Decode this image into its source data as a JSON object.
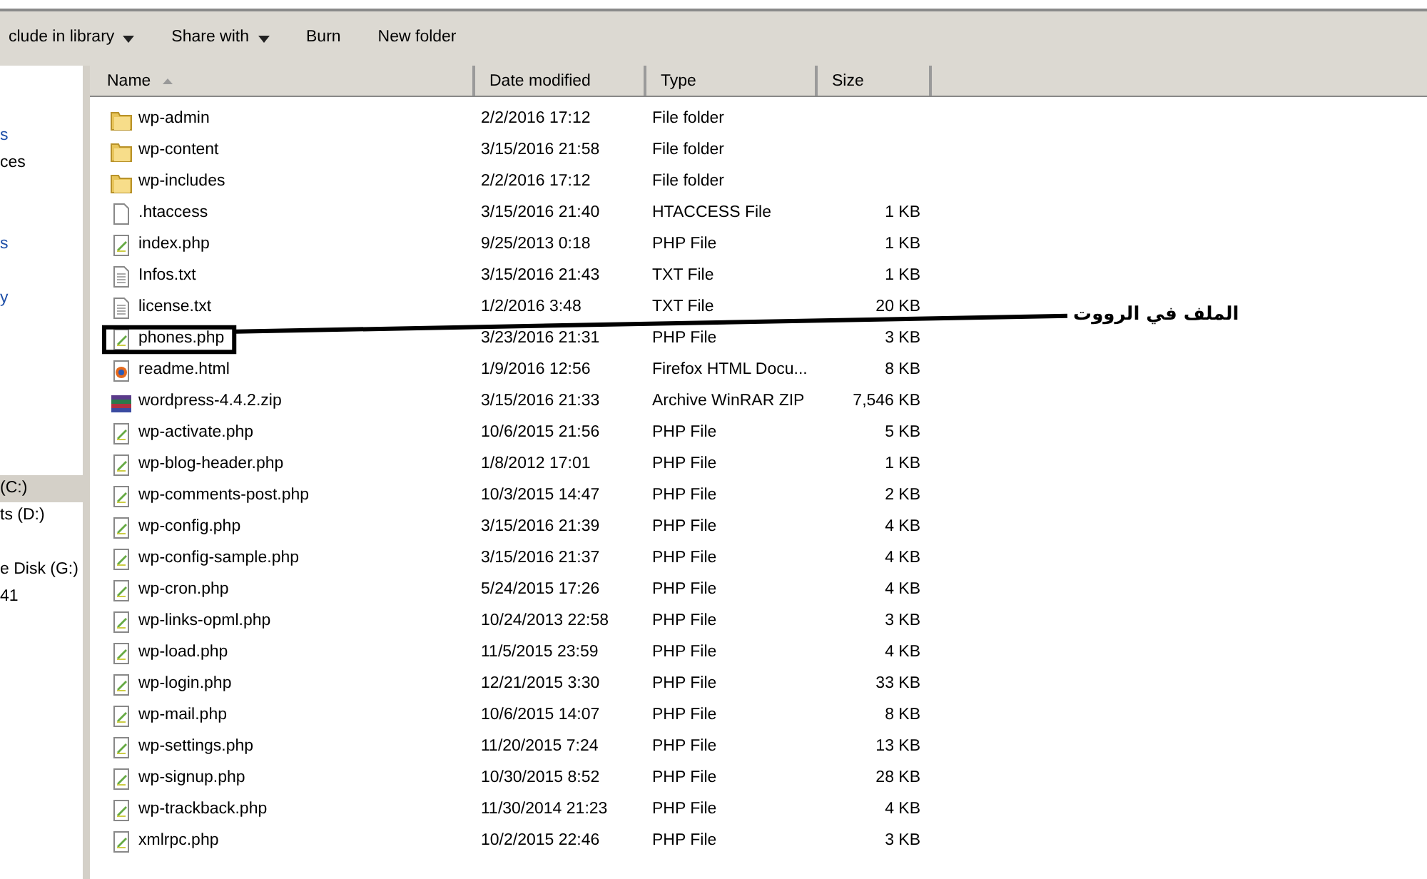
{
  "toolbar": [
    {
      "label": "clude in library",
      "dropdown": true
    },
    {
      "label": "Share with",
      "dropdown": true
    },
    {
      "label": "Burn",
      "dropdown": false
    },
    {
      "label": "New folder",
      "dropdown": false
    }
  ],
  "sidebar": {
    "items": [
      {
        "label": "s",
        "selected": false,
        "kind": "link"
      },
      {
        "label": "ces",
        "selected": false,
        "kind": "text"
      },
      {
        "label": "s",
        "selected": false,
        "kind": "link"
      },
      {
        "label": "y",
        "selected": false,
        "kind": "link"
      },
      {
        "label": "(C:)",
        "selected": true,
        "kind": "text"
      },
      {
        "label": "ts (D:)",
        "selected": false,
        "kind": "text"
      },
      {
        "label": "e Disk (G:)",
        "selected": false,
        "kind": "text"
      },
      {
        "label": "41",
        "selected": false,
        "kind": "text"
      }
    ]
  },
  "table": {
    "columns": [
      {
        "label": "Name",
        "sorted": true
      },
      {
        "label": "Date modified",
        "sorted": false
      },
      {
        "label": "Type",
        "sorted": false
      },
      {
        "label": "Size",
        "sorted": false
      }
    ],
    "rows": [
      {
        "name": "wp-admin",
        "kind": "folder",
        "date": "2/2/2016 17:12",
        "type": "File folder"
      },
      {
        "name": "wp-content",
        "kind": "folder",
        "date": "3/15/2016 21:58",
        "type": "File folder"
      },
      {
        "name": "wp-includes",
        "kind": "folder",
        "date": "2/2/2016 17:12",
        "type": "File folder"
      },
      {
        "name": ".htaccess",
        "kind": "blank",
        "date": "3/15/2016 21:40",
        "type": "HTACCESS File",
        "size": "1 KB"
      },
      {
        "name": "index.php",
        "kind": "php",
        "date": "9/25/2013 0:18",
        "type": "PHP File",
        "size": "1 KB"
      },
      {
        "name": "Infos.txt",
        "kind": "txt",
        "date": "3/15/2016 21:43",
        "type": "TXT File",
        "size": "1 KB"
      },
      {
        "name": "license.txt",
        "kind": "txt",
        "date": "1/2/2016 3:48",
        "type": "TXT File",
        "size": "20 KB"
      },
      {
        "name": "phones.php",
        "kind": "php",
        "date": "3/23/2016 21:31",
        "type": "PHP File",
        "size": "3 KB",
        "highlighted": true
      },
      {
        "name": "readme.html",
        "kind": "html",
        "date": "1/9/2016 12:56",
        "type": "Firefox HTML Docu...",
        "size": "8 KB"
      },
      {
        "name": "wordpress-4.4.2.zip",
        "kind": "zip",
        "date": "3/15/2016 21:33",
        "type": "Archive WinRAR ZIP",
        "size": "7,546 KB"
      },
      {
        "name": "wp-activate.php",
        "kind": "php",
        "date": "10/6/2015 21:56",
        "type": "PHP File",
        "size": "5 KB"
      },
      {
        "name": "wp-blog-header.php",
        "kind": "php",
        "date": "1/8/2012 17:01",
        "type": "PHP File",
        "size": "1 KB"
      },
      {
        "name": "wp-comments-post.php",
        "kind": "php",
        "date": "10/3/2015 14:47",
        "type": "PHP File",
        "size": "2 KB"
      },
      {
        "name": "wp-config.php",
        "kind": "php",
        "date": "3/15/2016 21:39",
        "type": "PHP File",
        "size": "4 KB"
      },
      {
        "name": "wp-config-sample.php",
        "kind": "php",
        "date": "3/15/2016 21:37",
        "type": "PHP File",
        "size": "4 KB"
      },
      {
        "name": "wp-cron.php",
        "kind": "php",
        "date": "5/24/2015 17:26",
        "type": "PHP File",
        "size": "4 KB"
      },
      {
        "name": "wp-links-opml.php",
        "kind": "php",
        "date": "10/24/2013 22:58",
        "type": "PHP File",
        "size": "3 KB"
      },
      {
        "name": "wp-load.php",
        "kind": "php",
        "date": "11/5/2015 23:59",
        "type": "PHP File",
        "size": "4 KB"
      },
      {
        "name": "wp-login.php",
        "kind": "php",
        "date": "12/21/2015 3:30",
        "type": "PHP File",
        "size": "33 KB"
      },
      {
        "name": "wp-mail.php",
        "kind": "php",
        "date": "10/6/2015 14:07",
        "type": "PHP File",
        "size": "8 KB"
      },
      {
        "name": "wp-settings.php",
        "kind": "php",
        "date": "11/20/2015 7:24",
        "type": "PHP File",
        "size": "13 KB"
      },
      {
        "name": "wp-signup.php",
        "kind": "php",
        "date": "10/30/2015 8:52",
        "type": "PHP File",
        "size": "28 KB"
      },
      {
        "name": "wp-trackback.php",
        "kind": "php",
        "date": "11/30/2014 21:23",
        "type": "PHP File",
        "size": "4 KB"
      },
      {
        "name": "xmlrpc.php",
        "kind": "php",
        "date": "10/2/2015 22:46",
        "type": "PHP File",
        "size": "3 KB"
      }
    ]
  },
  "annotation": {
    "text": "الملف في الرووت"
  }
}
